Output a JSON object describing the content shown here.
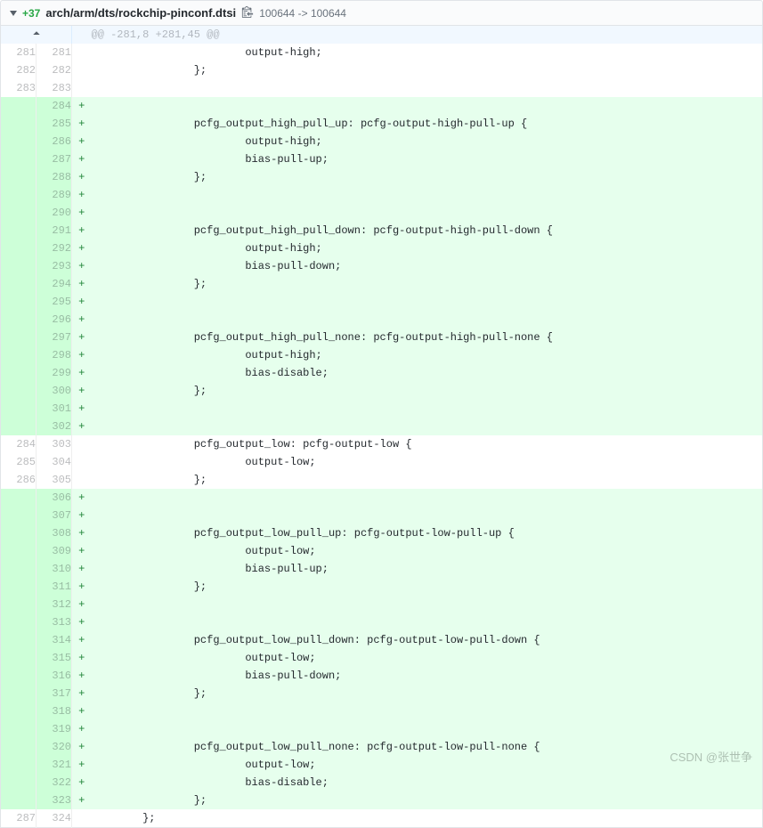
{
  "header": {
    "stat": "+37",
    "path": "arch/arm/dts/rockchip-pinconf.dtsi",
    "mode_from": "100644",
    "mode_arrow": "->",
    "mode_to": "100644"
  },
  "hunk": "@@ -281,8 +281,45 @@",
  "rows": [
    {
      "old": "281",
      "new": "281",
      "mark": "",
      "type": "ctx",
      "code": "                        output-high;"
    },
    {
      "old": "282",
      "new": "282",
      "mark": "",
      "type": "ctx",
      "code": "                };"
    },
    {
      "old": "283",
      "new": "283",
      "mark": "",
      "type": "ctx",
      "code": ""
    },
    {
      "old": "",
      "new": "284",
      "mark": "+",
      "type": "add",
      "code": ""
    },
    {
      "old": "",
      "new": "285",
      "mark": "+",
      "type": "add",
      "code": "                pcfg_output_high_pull_up: pcfg-output-high-pull-up {"
    },
    {
      "old": "",
      "new": "286",
      "mark": "+",
      "type": "add",
      "code": "                        output-high;"
    },
    {
      "old": "",
      "new": "287",
      "mark": "+",
      "type": "add",
      "code": "                        bias-pull-up;"
    },
    {
      "old": "",
      "new": "288",
      "mark": "+",
      "type": "add",
      "code": "                };"
    },
    {
      "old": "",
      "new": "289",
      "mark": "+",
      "type": "add",
      "code": ""
    },
    {
      "old": "",
      "new": "290",
      "mark": "+",
      "type": "add",
      "code": ""
    },
    {
      "old": "",
      "new": "291",
      "mark": "+",
      "type": "add",
      "code": "                pcfg_output_high_pull_down: pcfg-output-high-pull-down {"
    },
    {
      "old": "",
      "new": "292",
      "mark": "+",
      "type": "add",
      "code": "                        output-high;"
    },
    {
      "old": "",
      "new": "293",
      "mark": "+",
      "type": "add",
      "code": "                        bias-pull-down;"
    },
    {
      "old": "",
      "new": "294",
      "mark": "+",
      "type": "add",
      "code": "                };"
    },
    {
      "old": "",
      "new": "295",
      "mark": "+",
      "type": "add",
      "code": ""
    },
    {
      "old": "",
      "new": "296",
      "mark": "+",
      "type": "add",
      "code": ""
    },
    {
      "old": "",
      "new": "297",
      "mark": "+",
      "type": "add",
      "code": "                pcfg_output_high_pull_none: pcfg-output-high-pull-none {"
    },
    {
      "old": "",
      "new": "298",
      "mark": "+",
      "type": "add",
      "code": "                        output-high;"
    },
    {
      "old": "",
      "new": "299",
      "mark": "+",
      "type": "add",
      "code": "                        bias-disable;"
    },
    {
      "old": "",
      "new": "300",
      "mark": "+",
      "type": "add",
      "code": "                };"
    },
    {
      "old": "",
      "new": "301",
      "mark": "+",
      "type": "add",
      "code": ""
    },
    {
      "old": "",
      "new": "302",
      "mark": "+",
      "type": "add",
      "code": ""
    },
    {
      "old": "284",
      "new": "303",
      "mark": "",
      "type": "ctx",
      "code": "                pcfg_output_low: pcfg-output-low {"
    },
    {
      "old": "285",
      "new": "304",
      "mark": "",
      "type": "ctx",
      "code": "                        output-low;"
    },
    {
      "old": "286",
      "new": "305",
      "mark": "",
      "type": "ctx",
      "code": "                };"
    },
    {
      "old": "",
      "new": "306",
      "mark": "+",
      "type": "add",
      "code": ""
    },
    {
      "old": "",
      "new": "307",
      "mark": "+",
      "type": "add",
      "code": ""
    },
    {
      "old": "",
      "new": "308",
      "mark": "+",
      "type": "add",
      "code": "                pcfg_output_low_pull_up: pcfg-output-low-pull-up {"
    },
    {
      "old": "",
      "new": "309",
      "mark": "+",
      "type": "add",
      "code": "                        output-low;"
    },
    {
      "old": "",
      "new": "310",
      "mark": "+",
      "type": "add",
      "code": "                        bias-pull-up;"
    },
    {
      "old": "",
      "new": "311",
      "mark": "+",
      "type": "add",
      "code": "                };"
    },
    {
      "old": "",
      "new": "312",
      "mark": "+",
      "type": "add",
      "code": ""
    },
    {
      "old": "",
      "new": "313",
      "mark": "+",
      "type": "add",
      "code": ""
    },
    {
      "old": "",
      "new": "314",
      "mark": "+",
      "type": "add",
      "code": "                pcfg_output_low_pull_down: pcfg-output-low-pull-down {"
    },
    {
      "old": "",
      "new": "315",
      "mark": "+",
      "type": "add",
      "code": "                        output-low;"
    },
    {
      "old": "",
      "new": "316",
      "mark": "+",
      "type": "add",
      "code": "                        bias-pull-down;"
    },
    {
      "old": "",
      "new": "317",
      "mark": "+",
      "type": "add",
      "code": "                };"
    },
    {
      "old": "",
      "new": "318",
      "mark": "+",
      "type": "add",
      "code": ""
    },
    {
      "old": "",
      "new": "319",
      "mark": "+",
      "type": "add",
      "code": ""
    },
    {
      "old": "",
      "new": "320",
      "mark": "+",
      "type": "add",
      "code": "                pcfg_output_low_pull_none: pcfg-output-low-pull-none {"
    },
    {
      "old": "",
      "new": "321",
      "mark": "+",
      "type": "add",
      "code": "                        output-low;"
    },
    {
      "old": "",
      "new": "322",
      "mark": "+",
      "type": "add",
      "code": "                        bias-disable;"
    },
    {
      "old": "",
      "new": "323",
      "mark": "+",
      "type": "add",
      "code": "                };"
    },
    {
      "old": "287",
      "new": "324",
      "mark": "",
      "type": "ctx",
      "code": "        };"
    }
  ],
  "watermark": "CSDN @张世争"
}
